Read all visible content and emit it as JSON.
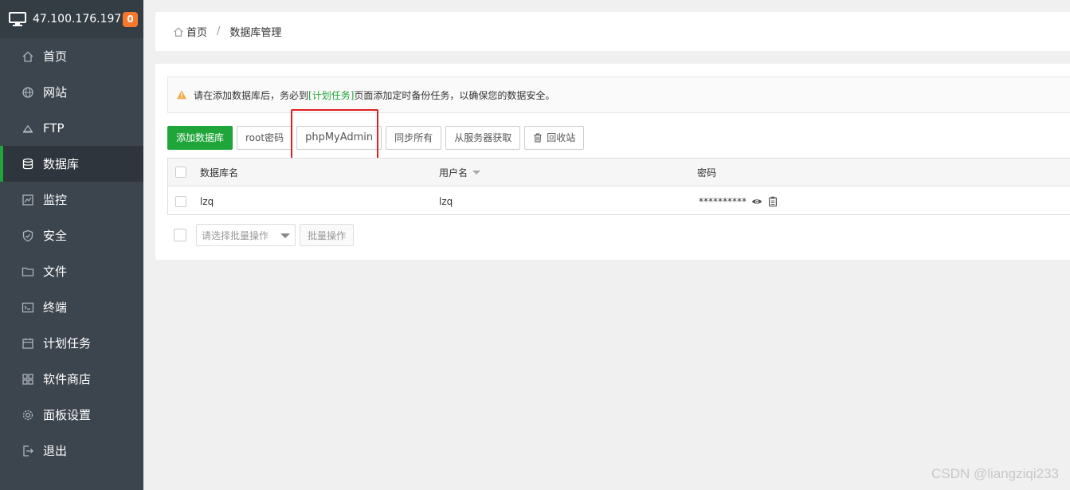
{
  "server": {
    "ip": "47.100.176.197",
    "badge": "0"
  },
  "sidebar": {
    "items": [
      {
        "label": "首页",
        "icon": "home-icon",
        "active": false
      },
      {
        "label": "网站",
        "icon": "globe-icon",
        "active": false
      },
      {
        "label": "FTP",
        "icon": "ftp-icon",
        "active": false
      },
      {
        "label": "数据库",
        "icon": "database-icon",
        "active": true
      },
      {
        "label": "监控",
        "icon": "monitor-icon",
        "active": false
      },
      {
        "label": "安全",
        "icon": "shield-icon",
        "active": false
      },
      {
        "label": "文件",
        "icon": "folder-icon",
        "active": false
      },
      {
        "label": "终端",
        "icon": "terminal-icon",
        "active": false
      },
      {
        "label": "计划任务",
        "icon": "calendar-icon",
        "active": false
      },
      {
        "label": "软件商店",
        "icon": "apps-icon",
        "active": false
      },
      {
        "label": "面板设置",
        "icon": "gear-icon",
        "active": false
      },
      {
        "label": "退出",
        "icon": "logout-icon",
        "active": false
      }
    ]
  },
  "breadcrumb": {
    "home": "首页",
    "separator": "/",
    "current": "数据库管理"
  },
  "alert": {
    "text_before": "请在添加数据库后，务必到",
    "link": "[计划任务]",
    "text_after": "页面添加定时备份任务，以确保您的数据安全。"
  },
  "toolbar": {
    "add": "添加数据库",
    "root_pwd": "root密码",
    "phpmyadmin": "phpMyAdmin",
    "sync_all": "同步所有",
    "from_server": "从服务器获取",
    "recycle": "回收站"
  },
  "table": {
    "headers": {
      "name": "数据库名",
      "user": "用户名",
      "password": "密码"
    },
    "rows": [
      {
        "name": "lzq",
        "user": "lzq",
        "password": "**********"
      }
    ]
  },
  "batch": {
    "select_placeholder": "请选择批量操作",
    "button": "批量操作"
  },
  "watermark": "CSDN @liangziqi233",
  "colors": {
    "accent": "#20a53a",
    "sidebar": "#3c444d",
    "badge": "#f7782d",
    "highlight": "#e0201f"
  }
}
